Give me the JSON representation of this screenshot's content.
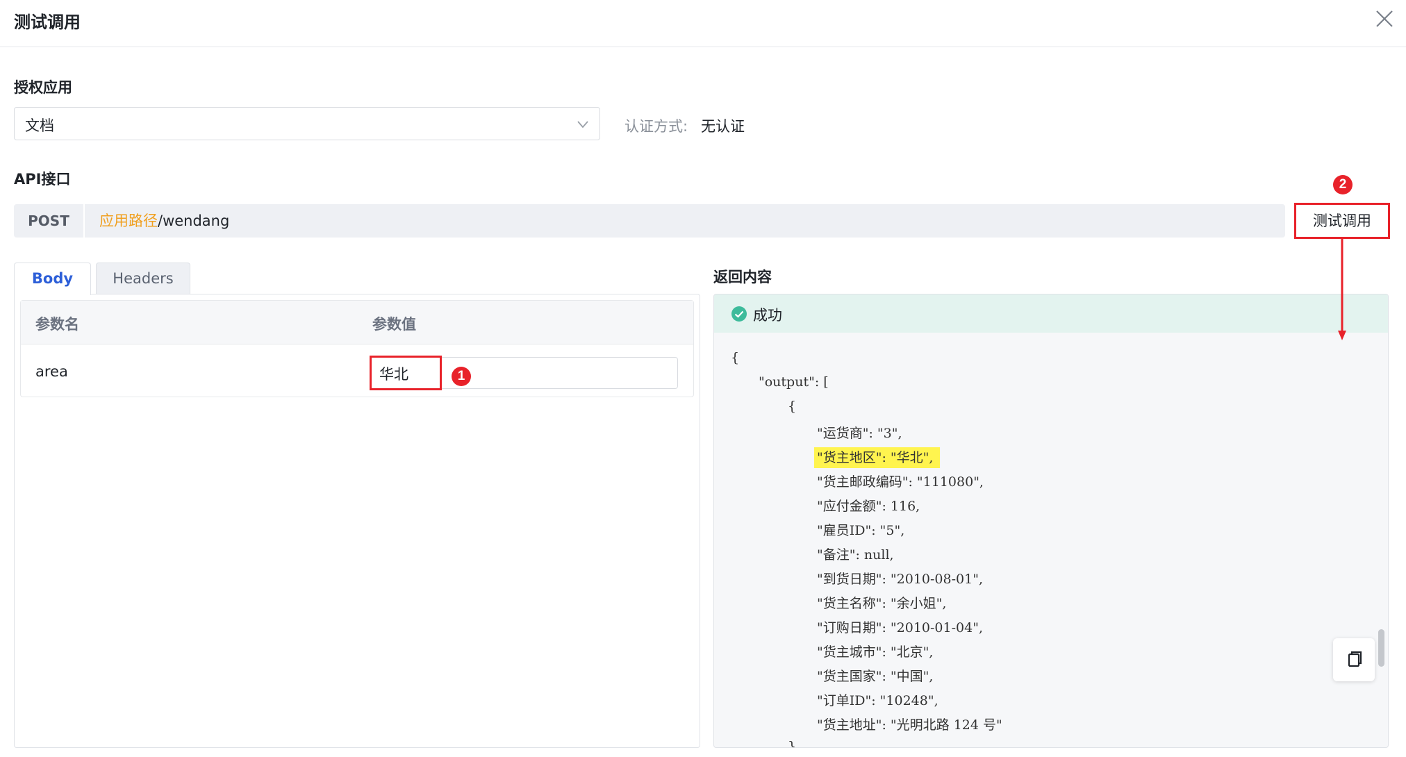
{
  "dialog": {
    "title": "测试调用"
  },
  "auth_app": {
    "label": "授权应用",
    "selected": "文档",
    "auth_method_label": "认证方式:",
    "auth_method_value": "无认证"
  },
  "api": {
    "label": "API接口",
    "method": "POST",
    "path_prefix": "应用路径",
    "path_suffix": "/wendang",
    "test_button": "测试调用"
  },
  "tabs": [
    {
      "label": "Body",
      "active": true
    },
    {
      "label": "Headers",
      "active": false
    }
  ],
  "params_table": {
    "headers": [
      "参数名",
      "参数值"
    ],
    "rows": [
      {
        "name": "area",
        "value": "华北"
      }
    ]
  },
  "response": {
    "label": "返回内容",
    "status": "成功",
    "lines": [
      "{",
      "\"output\": [",
      "{",
      "\"运货商\": \"3\",",
      "\"货主地区\": \"华北\",",
      "\"货主邮政编码\": \"111080\",",
      "\"应付金额\": 116,",
      "\"雇员ID\": \"5\",",
      "\"备注\": null,",
      "\"到货日期\": \"2010-08-01\",",
      "\"货主名称\": \"余小姐\",",
      "\"订购日期\": \"2010-01-04\",",
      "\"货主城市\": \"北京\",",
      "\"货主国家\": \"中国\",",
      "\"订单ID\": \"10248\",",
      "\"货主地址\": \"光明北路 124 号\"",
      "}"
    ]
  },
  "annotations": {
    "badge_1": "1",
    "badge_2": "2",
    "color": "#e8222a"
  },
  "colors": {
    "accent_blue": "#2d5fd8",
    "path_orange": "#f0a020",
    "success_green": "#3dbb9b",
    "highlight_yellow": "#fff44f"
  },
  "icons": [
    "close-icon",
    "chevron-down-icon",
    "check-circle-icon",
    "copy-icon"
  ]
}
